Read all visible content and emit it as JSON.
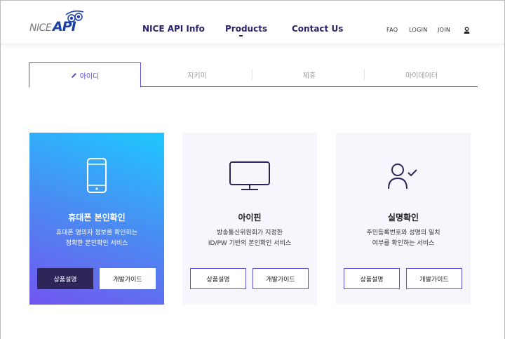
{
  "logo": {
    "nice": "NICE",
    "api": "API",
    "accent": "#1a3fa8"
  },
  "nav": [
    {
      "label": "NICE API Info"
    },
    {
      "label": "Products"
    },
    {
      "label": "Contact Us"
    }
  ],
  "utility": {
    "faq": "FAQ",
    "login": "LOGIN",
    "join": "JOIN",
    "icon": "user-icon"
  },
  "tabs": [
    {
      "label": "아이디",
      "active": true,
      "icon": "pencil-icon"
    },
    {
      "label": "지키미"
    },
    {
      "label": "제휴"
    },
    {
      "label": "마이데이터"
    }
  ],
  "cards": [
    {
      "icon": "phone-icon",
      "title": "휴대폰 본인확인",
      "desc_line1": "휴대폰 명의자 정보를 확인하는",
      "desc_line2": "정확한 본인확인 서비스",
      "btn_info": "상품설명",
      "btn_guide": "개발가이드"
    },
    {
      "icon": "monitor-icon",
      "title": "아이핀",
      "desc_line1": "방송통신위원회가 지정한",
      "desc_line2": "ID/PW 기반의 본인확인 서비스",
      "btn_info": "상품설명",
      "btn_guide": "개발가이드"
    },
    {
      "icon": "user-check-icon",
      "title": "실명확인",
      "desc_line1": "주민등록번호와 성명의 일치",
      "desc_line2": "여부를 확인하는 서비스",
      "btn_info": "상품설명",
      "btn_guide": "개발가이드"
    }
  ],
  "colors": {
    "primary": "#5b4fd8",
    "navy": "#2e2659",
    "gradient_start": "#1ec8ff",
    "gradient_end": "#7256ef"
  }
}
